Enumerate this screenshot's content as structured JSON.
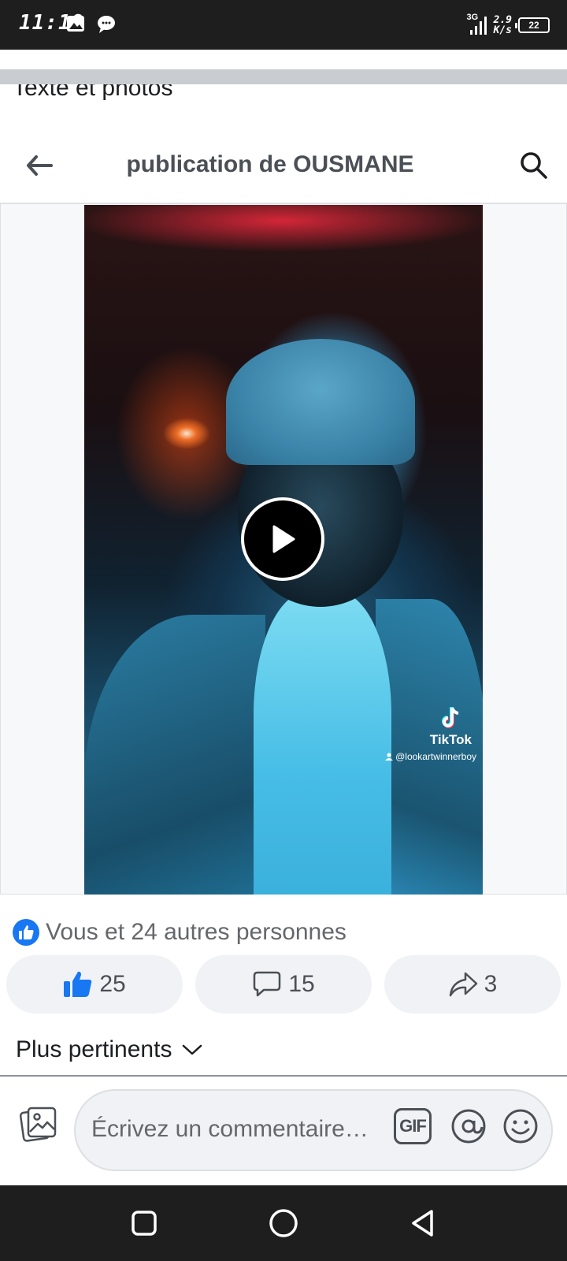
{
  "status_bar": {
    "time": "11:19",
    "network": "3G",
    "speed_value": "2.9",
    "speed_unit": "K/s",
    "battery": "22",
    "icons": [
      "image-icon",
      "chat-bubble-icon",
      "signal-icon",
      "battery-icon"
    ]
  },
  "tab_remnant": "Texte et photos",
  "header": {
    "title": "publication de OUSMANE",
    "icons": [
      "back-arrow-icon",
      "search-icon"
    ]
  },
  "video": {
    "watermark_brand": "TikTok",
    "watermark_user": "@lookartwinnerboy",
    "icons": [
      "play-icon",
      "tiktok-logo-icon"
    ]
  },
  "reactions": {
    "summary": "Vous et 24 autres personnes"
  },
  "actions": {
    "likes": "25",
    "comments": "15",
    "shares": "3",
    "icons": [
      "thumbs-up-icon",
      "comment-icon",
      "share-icon"
    ]
  },
  "sort": {
    "label": "Plus pertinents"
  },
  "composer": {
    "placeholder": "Écrivez un commentaire…",
    "gif_label": "GIF",
    "icons": [
      "photo-icon",
      "mention-icon",
      "emoji-icon"
    ]
  },
  "nav": {
    "icons": [
      "recents-square-icon",
      "home-circle-icon",
      "back-triangle-icon"
    ]
  },
  "colors": {
    "facebook_blue": "#1877f2",
    "status_bar": "#1e1e1e",
    "button_grey": "#f0f2f5",
    "secondary_text": "#65676b"
  }
}
